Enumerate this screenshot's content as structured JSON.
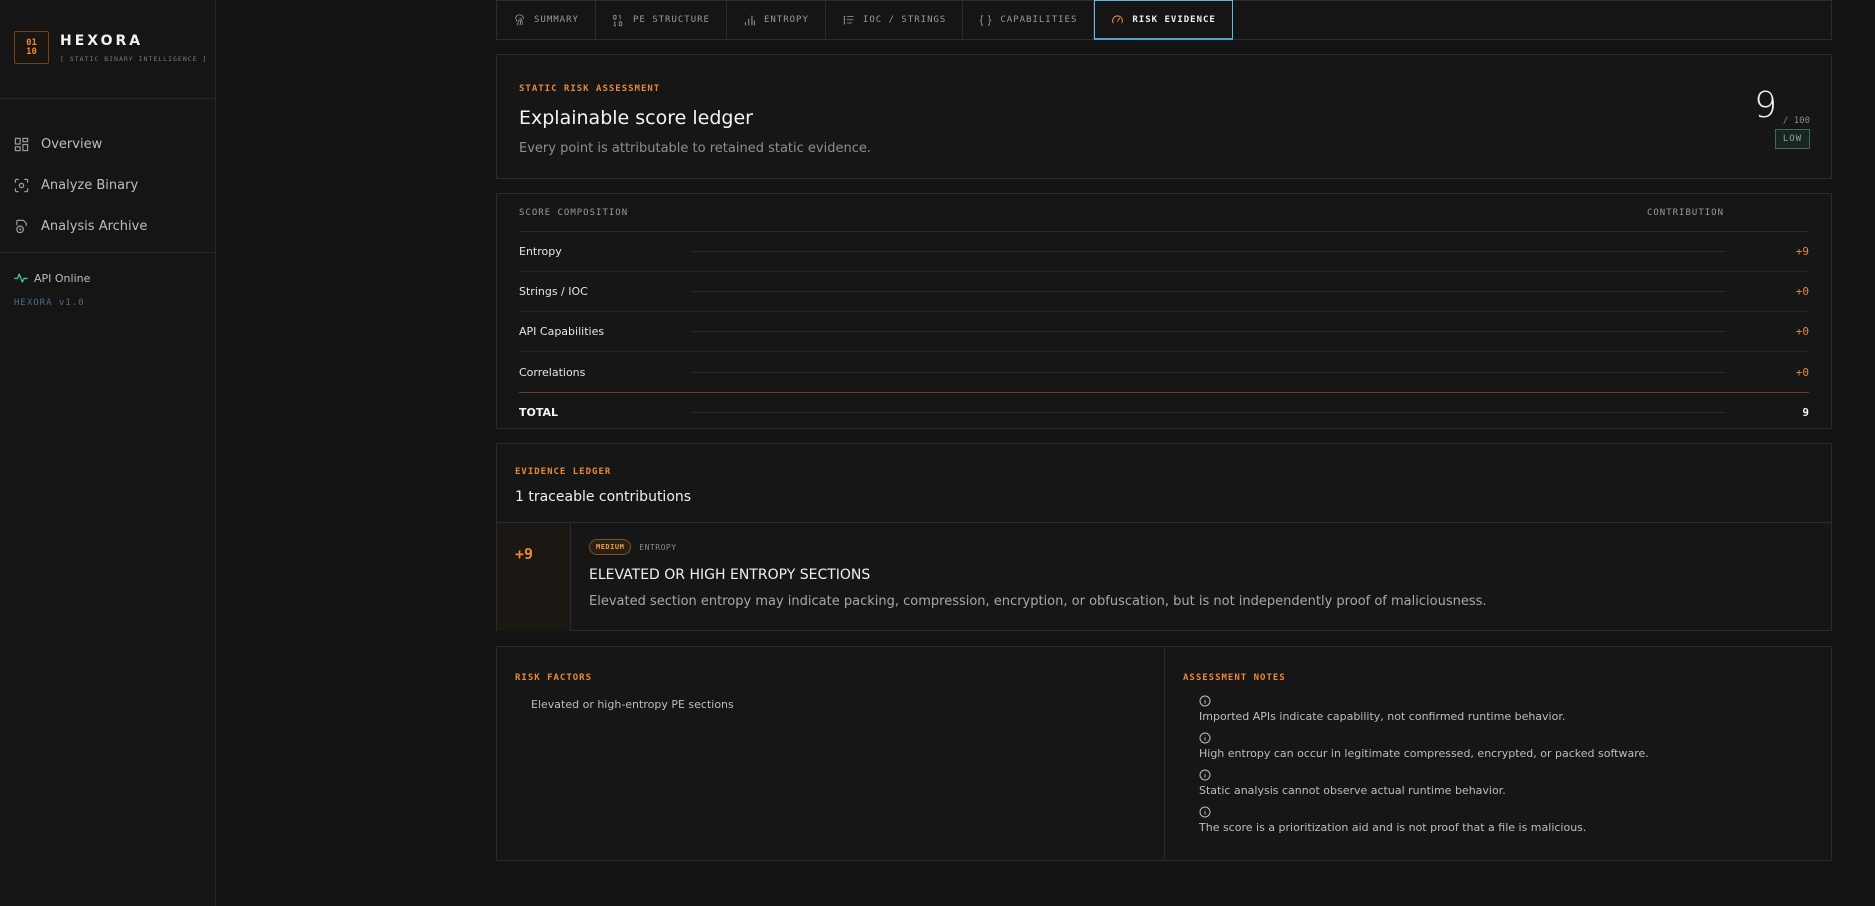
{
  "brand": {
    "logo_top": "01",
    "logo_bottom": "10",
    "name": "HEXORA",
    "tagline": "[ STATIC BINARY INTELLIGENCE ]"
  },
  "nav": {
    "items": [
      {
        "label": "Overview",
        "icon": "dashboard-icon"
      },
      {
        "label": "Analyze Binary",
        "icon": "scan-icon"
      },
      {
        "label": "Analysis Archive",
        "icon": "archive-icon"
      }
    ]
  },
  "status": {
    "api": "API Online",
    "version": "HEXORA v1.0",
    "color": "#3fc79a"
  },
  "tabs": [
    {
      "label": "SUMMARY",
      "icon": "fingerprint-icon"
    },
    {
      "label": "PE STRUCTURE",
      "icon": "binary-icon"
    },
    {
      "label": "ENTROPY",
      "icon": "bar-chart-icon"
    },
    {
      "label": "IOC / STRINGS",
      "icon": "list-icon"
    },
    {
      "label": "CAPABILITIES",
      "icon": "braces-icon"
    },
    {
      "label": "RISK EVIDENCE",
      "icon": "gauge-icon",
      "active": true
    }
  ],
  "header": {
    "eyebrow": "STATIC RISK ASSESSMENT",
    "title": "Explainable score ledger",
    "subtitle": "Every point is attributable to retained static evidence.",
    "score": "9",
    "score_max": "/ 100",
    "level": "LOW"
  },
  "composition": {
    "col_label": "SCORE COMPOSITION",
    "col_contribution": "CONTRIBUTION",
    "rows": [
      {
        "label": "Entropy",
        "value": "+9"
      },
      {
        "label": "Strings / IOC",
        "value": "+0"
      },
      {
        "label": "API Capabilities",
        "value": "+0"
      },
      {
        "label": "Correlations",
        "value": "+0"
      }
    ],
    "total_label": "TOTAL",
    "total_value": "9"
  },
  "evidence": {
    "eyebrow": "EVIDENCE LEDGER",
    "title": "1 traceable contributions",
    "items": [
      {
        "points": "+9",
        "severity": "MEDIUM",
        "category": "ENTROPY",
        "name": "ELEVATED OR HIGH ENTROPY SECTIONS",
        "description": "Elevated section entropy may indicate packing, compression, encryption, or obfuscation, but is not independently proof of maliciousness."
      }
    ]
  },
  "risk_factors": {
    "eyebrow": "RISK FACTORS",
    "items": [
      "Elevated or high-entropy PE sections"
    ]
  },
  "assessment_notes": {
    "eyebrow": "ASSESSMENT NOTES",
    "items": [
      "Imported APIs indicate capability, not confirmed runtime behavior.",
      "High entropy can occur in legitimate compressed, encrypted, or packed software.",
      "Static analysis cannot observe actual runtime behavior.",
      "The score is a prioritization aid and is not proof that a file is malicious."
    ]
  },
  "colors": {
    "accent": "#e8883e",
    "active_tab_border": "#6ab4e0"
  }
}
